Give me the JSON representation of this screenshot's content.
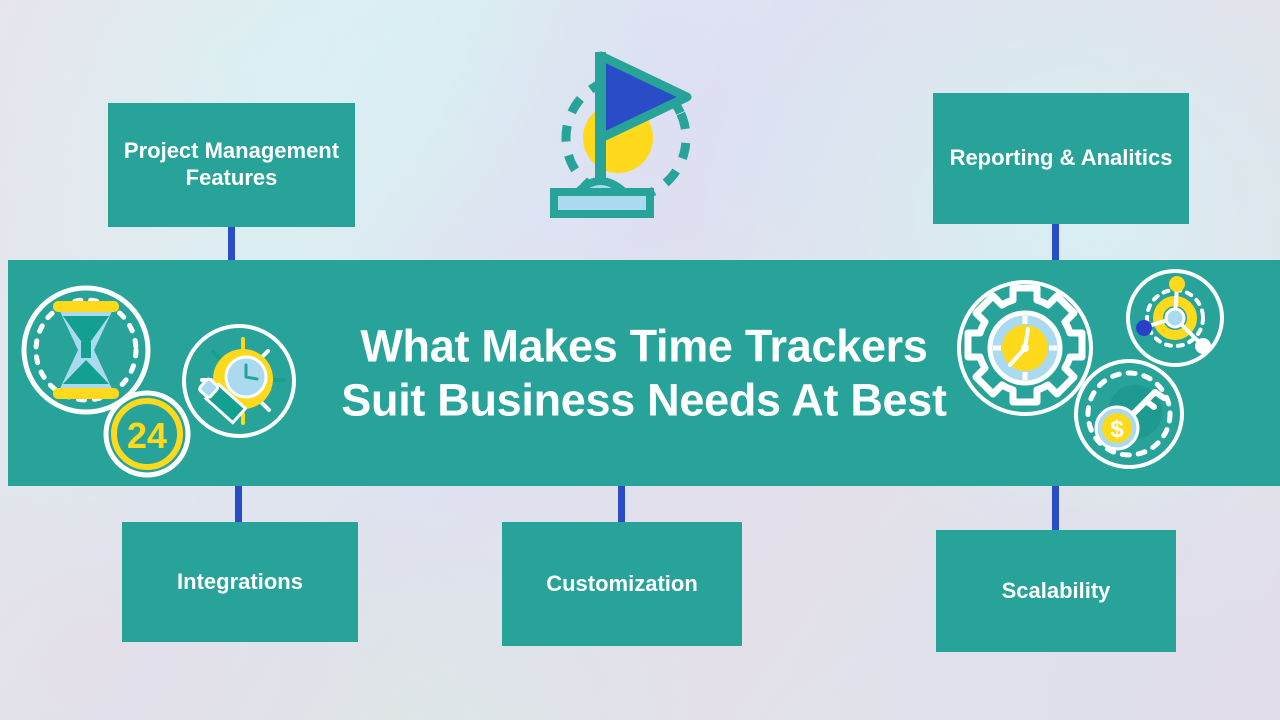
{
  "banner": {
    "title": "What Makes Time Trackers Suit Business Needs At Best",
    "color": "#27a39a"
  },
  "theme": {
    "teal": "#27a39a",
    "blue": "#2a4cc7",
    "yellow": "#ffd91c",
    "light_blue": "#a9daef",
    "white": "#ffffff",
    "background": "pastel gradient lavender to mint"
  },
  "nodes": {
    "top": [
      {
        "id": "project-management-features",
        "label": "Project Management Features"
      },
      {
        "id": "reporting-analitics",
        "label": "Reporting & Analitics"
      }
    ],
    "bottom": [
      {
        "id": "integrations",
        "label": "Integrations"
      },
      {
        "id": "customization",
        "label": "Customization"
      },
      {
        "id": "scalability",
        "label": "Scalability"
      }
    ]
  },
  "icons": {
    "flag": "flag-milestone-icon",
    "hourglass": "hourglass-icon",
    "badge_24": "24-hours-badge-icon",
    "badge_24_text": "24",
    "lightbulb_clock": "lightbulb-clock-icon",
    "gear_clock": "gear-clock-icon",
    "network": "network-nodes-icon",
    "money_key": "dollar-key-icon",
    "money_symbol": "$"
  }
}
